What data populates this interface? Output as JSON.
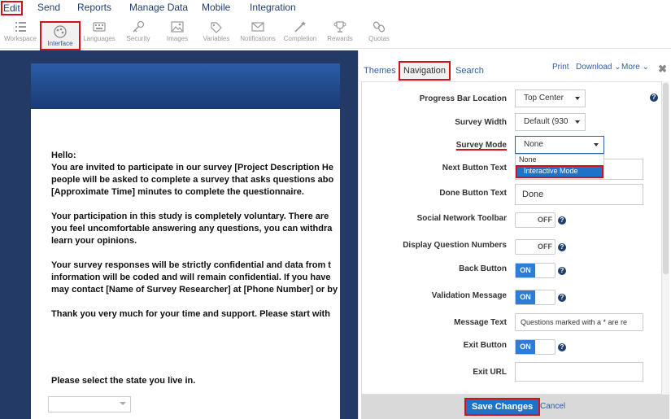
{
  "top_menu": [
    "Edit",
    "Send",
    "Reports",
    "Manage Data",
    "Mobile",
    "Integration"
  ],
  "toolbar": [
    "Workspace",
    "Interface",
    "Languages",
    "Security",
    "Images",
    "Variables",
    "Notifications",
    "Completion",
    "Rewards",
    "Quotas"
  ],
  "survey": {
    "greeting": "Hello:",
    "p1": [
      "You are invited to participate in our survey [Project Description He",
      "people will be asked to complete a survey that asks questions abo",
      "[Approximate Time] minutes to complete the questionnaire."
    ],
    "p2": [
      "Your participation in this study is completely voluntary. There are",
      "you feel uncomfortable answering any questions, you can withdra",
      "learn your opinions."
    ],
    "p3": [
      "Your survey responses will be strictly confidential and data from t",
      "information will be coded and will remain confidential. If you have",
      "may contact [Name of Survey Researcher] at [Phone Number] or by"
    ],
    "p4": "Thank you very much for your time and support. Please start with",
    "question": "Please select the state you live in.",
    "select_value": ""
  },
  "panel": {
    "tabs": {
      "themes": "Themes",
      "navigation": "Navigation",
      "search": "Search"
    },
    "links": {
      "print": "Print",
      "download": "Download",
      "more": "More"
    },
    "close": "✖",
    "labels": {
      "progress": "Progress Bar Location",
      "width": "Survey Width",
      "mode": "Survey Mode",
      "next": "Next Button Text",
      "done": "Done Button Text",
      "social": "Social Network Toolbar",
      "qnum": "Display Question Numbers",
      "back": "Back Button",
      "valid": "Validation Message",
      "msg": "Message Text",
      "exit": "Exit Button",
      "exiturl": "Exit URL"
    },
    "values": {
      "progress": "Top Center",
      "width": "Default (930",
      "mode": "None",
      "done": "Done",
      "msg": "Questions marked with a * are re",
      "exiturl": "",
      "next": ""
    },
    "mode_options": [
      "None",
      "Interactive Mode"
    ],
    "toggle_on": "ON",
    "toggle_off": "OFF",
    "help": "?",
    "save": "Save Changes",
    "cancel": "Cancel"
  }
}
